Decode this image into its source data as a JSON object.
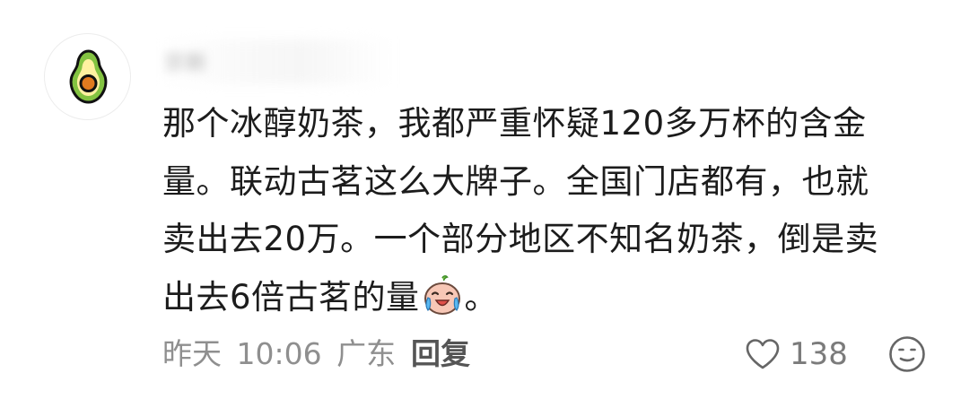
{
  "comment": {
    "author": "宗新",
    "lines": [
      "那个冰醇奶茶，我都严重怀疑120多万杯的含金",
      "量。联动古茗这么大牌子。全国门店都有，也就",
      "卖出去20万。一个部分地区不知名奶茶，倒是卖",
      "出去6倍古茗的量"
    ],
    "trailing_punct": "。",
    "emoji_icon": "crying-face-emoji",
    "time": "昨天",
    "clock": "10:06",
    "location": "广东",
    "reply_label": "回复",
    "likes": "138"
  },
  "icons": {
    "avatar": "avocado-avatar-icon",
    "like": "heart-outline-icon",
    "react": "smiley-face-icon"
  },
  "colors": {
    "text": "#1c1c1c",
    "meta": "#8f8f8f",
    "avocado_skin": "#83c341",
    "avocado_flesh": "#fff1a0",
    "avocado_pit": "#e07a1f"
  }
}
